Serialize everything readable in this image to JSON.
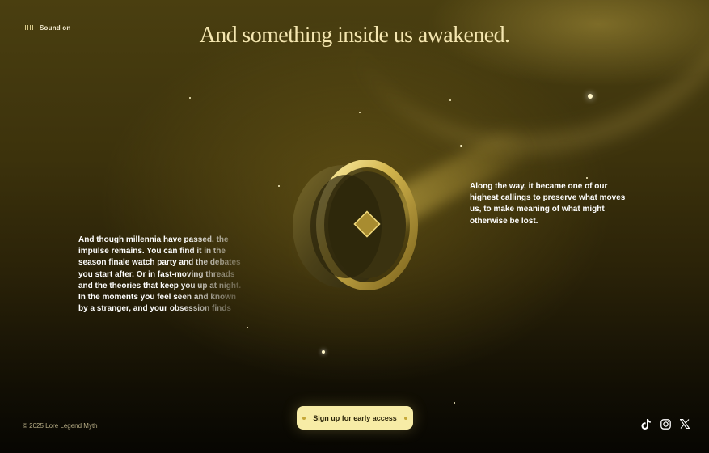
{
  "sound": {
    "label": "Sound on"
  },
  "headline": "And something inside us awakened.",
  "paragraph_left": "And though millennia have passed, the impulse remains. You can find it in the season finale watch party and the debates you start after. Or in fast-moving threads and the theories that keep you up at night. In the moments you feel seen and known by a stranger, and your obsession finds",
  "paragraph_right": "Along the way, it became one of our highest callings to preserve what moves us, to make meaning of what might otherwise be lost.",
  "cta": {
    "label": "Sign up for early access"
  },
  "footer": {
    "copyright": "© 2025 Lore Legend Myth"
  },
  "socials": [
    {
      "icon": "tiktok-icon"
    },
    {
      "icon": "instagram-icon"
    },
    {
      "icon": "x-icon"
    }
  ],
  "colors": {
    "accent": "#f7eca6",
    "headline": "#f4e6b0",
    "background": "#3c320c"
  }
}
